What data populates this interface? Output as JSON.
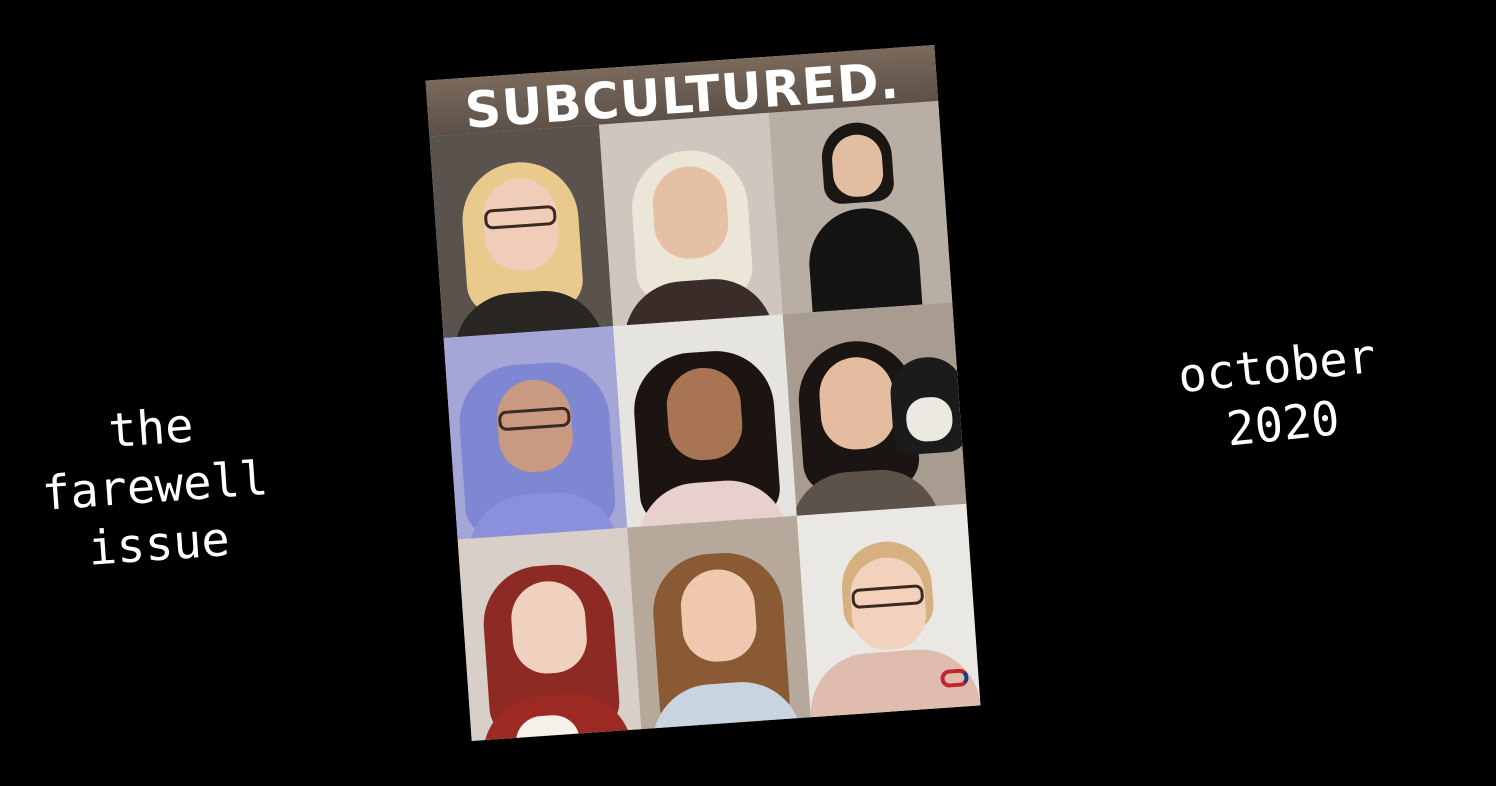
{
  "cover": {
    "masthead": "SUBCULTURED."
  },
  "left_caption": {
    "lines": [
      "the",
      "farewell",
      "issue"
    ]
  },
  "right_caption": {
    "lines": [
      "october",
      "2020"
    ]
  },
  "colors": {
    "background": "#000000",
    "text": "#ffffff",
    "masthead_text": "#ffffff"
  }
}
